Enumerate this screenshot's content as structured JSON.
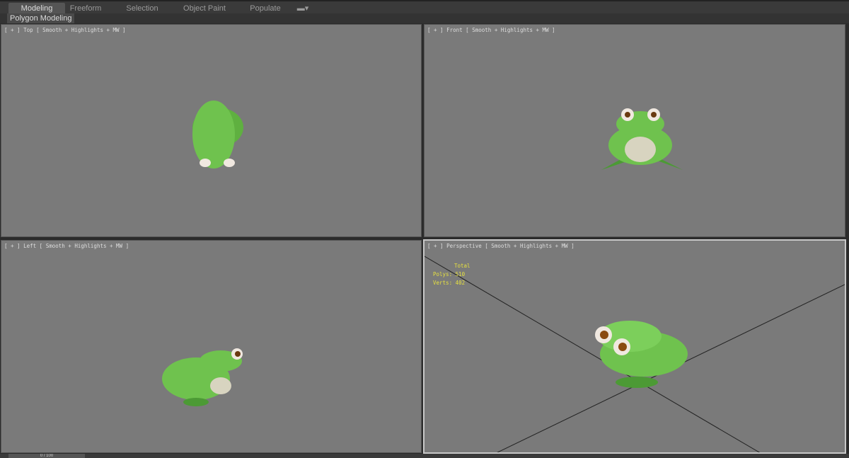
{
  "ribbon": {
    "tabs": [
      "Modeling",
      "Freeform",
      "Selection",
      "Object Paint",
      "Populate"
    ],
    "active": "Modeling",
    "subtab": "Polygon Modeling"
  },
  "viewports": [
    {
      "name": "Top",
      "label": "[ + ] Top [ Smooth + Highlights + MW ]"
    },
    {
      "name": "Front",
      "label": "[ + ] Front [ Smooth + Highlights + MW ]"
    },
    {
      "name": "Left",
      "label": "[ + ] Left [ Smooth + Highlights + MW ]"
    },
    {
      "name": "Perspective",
      "label": "[ + ] Perspective [ Smooth + Highlights + MW ]"
    }
  ],
  "stats": {
    "header": "Total",
    "polys": "Polys: 510",
    "verts": "Verts: 402"
  },
  "timeslider": {
    "value": "0 / 100"
  },
  "colors": {
    "frog": "#6fc24e",
    "viewport_bg": "#7a7a7a"
  }
}
